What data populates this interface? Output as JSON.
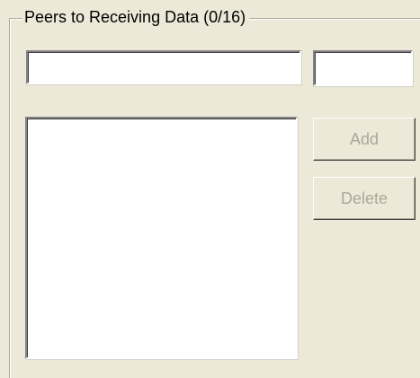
{
  "group": {
    "title": "Peers to Receiving Data (0/16)"
  },
  "peer_input": {
    "value": "",
    "placeholder": ""
  },
  "port_input": {
    "value": "",
    "placeholder": ""
  },
  "peer_list": {
    "items": []
  },
  "buttons": {
    "add_label": "Add",
    "add_enabled": false,
    "delete_label": "Delete",
    "delete_enabled": false
  },
  "colors": {
    "background": "#ece9d8",
    "disabled_text": "#aca899"
  }
}
